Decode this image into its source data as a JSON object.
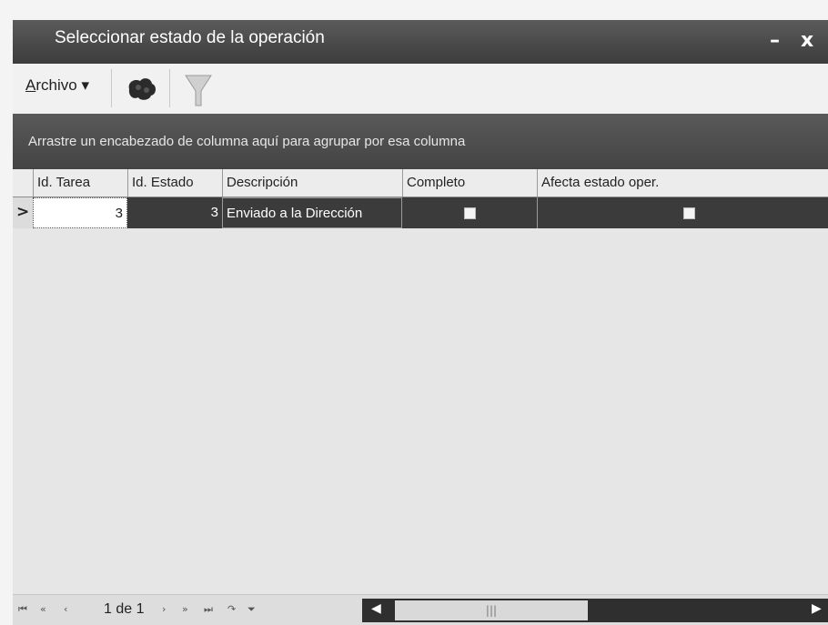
{
  "window": {
    "title": "Seleccionar estado de la operación",
    "minimize_glyph": "–",
    "close_glyph": "x"
  },
  "toolbar": {
    "archivo_prefix": "A",
    "archivo_rest": "rchivo",
    "archivo_arrow": "▾",
    "icons": [
      "refresh-blob-icon",
      "filter-funnel-icon"
    ]
  },
  "grid": {
    "group_hint": "Arrastre un encabezado de columna aquí para agrupar por esa columna",
    "columns": [
      "Id. Tarea",
      "Id. Estado",
      "Descripción",
      "Completo",
      "Afecta estado oper."
    ],
    "rows": [
      {
        "indicator": ">",
        "id_tarea": "3",
        "id_estado": "3",
        "descripcion": "Enviado a la Dirección",
        "completo": false,
        "afecta_estado": false
      }
    ]
  },
  "footer": {
    "nav_first": "⏮",
    "nav_prev_page": "«",
    "nav_prev": "‹",
    "page_text": "1 de 1",
    "nav_next": "›",
    "nav_next_page": "»",
    "nav_last": "⏭",
    "nav_refresh": "↷",
    "nav_filter": "⏷",
    "scroll_left": "◀",
    "scroll_right": "▶",
    "scroll_grip": "|||"
  },
  "colors": {
    "titlebar": "#4a4a4a",
    "group_bar": "#4f4f4f",
    "selected_row": "#3b3b3b",
    "background": "#e6e6e6"
  }
}
